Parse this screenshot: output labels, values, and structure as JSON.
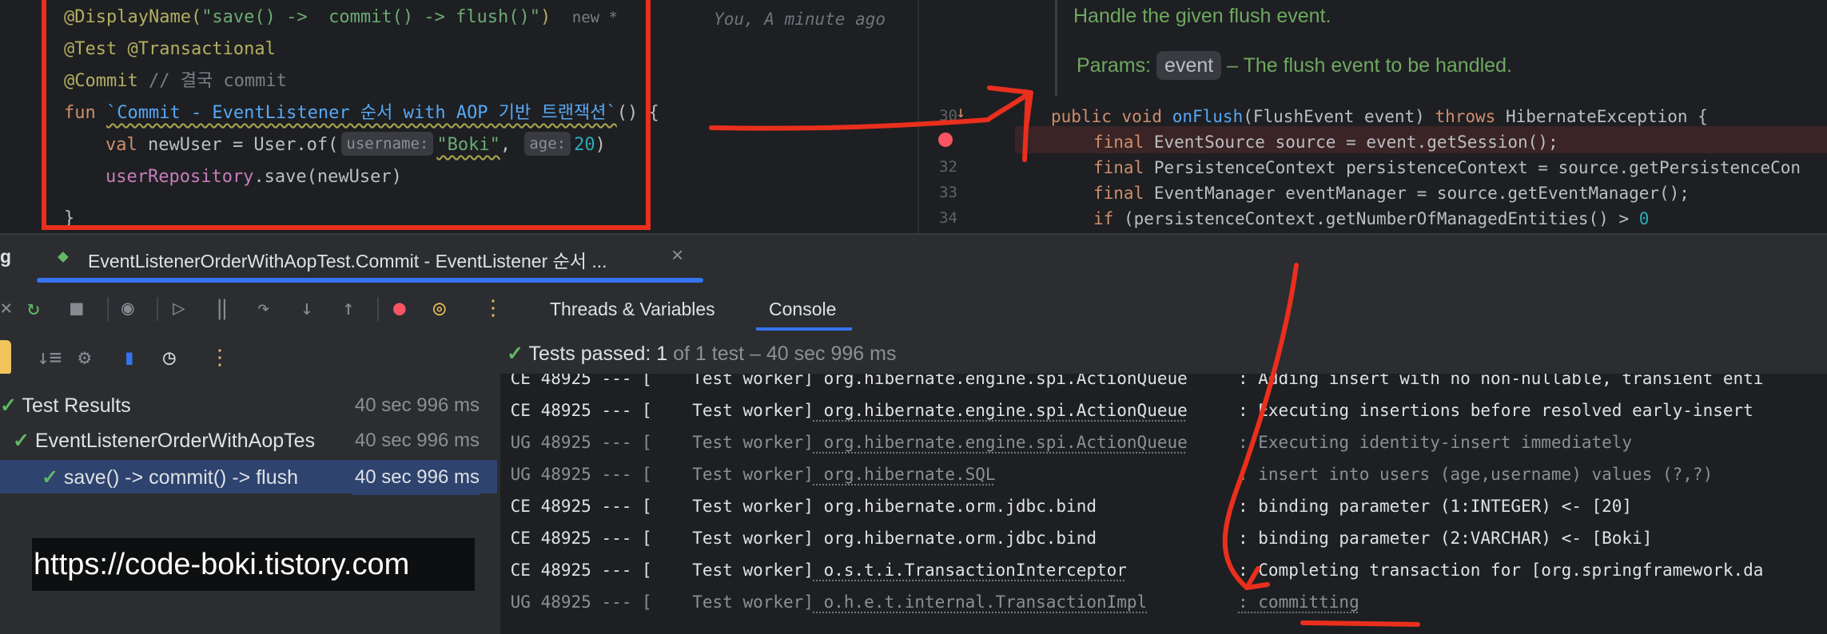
{
  "editor_left": {
    "line1_ann": "@DisplayName(",
    "line1_str": "\"save() ->  commit() -> flush()\"",
    "line1_close": ")",
    "line1_badge": "new *",
    "author": "You, A minute ago",
    "line2": "@Test @Transactional",
    "line3_ann": "@Commit",
    "line3_cmt": " // 결국 commit",
    "line4_kw": "fun ",
    "line4_name": "`Commit - EventListener 순서 with AOP 기반 트랜잭션`",
    "line4_tail": "() {",
    "line5_kw": "val ",
    "line5_a": "newUser = User.of(",
    "line5_hint1": "username:",
    "line5_str": "\"Boki\"",
    "line5_comma": ",",
    "line5_hint2": "age:",
    "line5_num": "20",
    "line5_close": ")",
    "line6_prop": "userRepository",
    "line6_rest": ".save(newUser)",
    "line7": "}"
  },
  "editor_right": {
    "doc_line1": "Handle the given flush event.",
    "doc_params": "Params:",
    "doc_chip": "event",
    "doc_desc": "– The flush event to be handled.",
    "gutter": [
      "30",
      "32",
      "33",
      "34"
    ],
    "code": {
      "l30_kw": "public void ",
      "l30_fn": "onFlush",
      "l30_a": "(FlushEvent event) ",
      "l30_kw2": "throws ",
      "l30_b": "HibernateException {",
      "l31_kw": "final ",
      "l31_a": "EventSource source = event.getSession();",
      "l32_kw": "final ",
      "l32_a": "PersistenceContext persistenceContext = source.getPersistenceCon",
      "l33_kw": "final ",
      "l33_a": "EventManager eventManager = source.getEventManager();",
      "l34_kw": "if ",
      "l34_a": "(persistenceContext.getNumberOfManagedEntities() > ",
      "l34_num": "0"
    }
  },
  "toolwindow": {
    "left_cut": "g",
    "tab_title": "EventListenerOrderWithAopTest.Commit - EventListener 순서 ...",
    "tab_close": "×",
    "tabs": [
      "Threads & Variables",
      "Console"
    ],
    "active_tab": "Console",
    "status": {
      "label": "Tests passed: ",
      "count": "1",
      "rest": " of 1 test – 40 sec 996 ms"
    }
  },
  "test_tree": [
    {
      "label": "Test Results",
      "time": "40 sec 996 ms"
    },
    {
      "label": "EventListenerOrderWithAopTes",
      "time": "40 sec 996 ms"
    },
    {
      "label": "save() -> commit() -> flush",
      "time": "40 sec 996 ms"
    }
  ],
  "console_lines": [
    {
      "lvl": "CE 48925 --- [",
      "thread": "    Test worker]",
      "logger": " org.hibernate.engine.spi.ActionQueue",
      "msg": ": Adding insert with no non-nullable, transient enti"
    },
    {
      "lvl": "CE 48925 --- [",
      "thread": "    Test worker]",
      "logger": " org.hibernate.engine.spi.ActionQueue",
      "msg": ": Executing insertions before resolved early-insert"
    },
    {
      "lvl": "UG 48925 --- [",
      "thread": "    Test worker]",
      "logger": " org.hibernate.engine.spi.ActionQueue",
      "msg": ": Executing identity-insert immediately"
    },
    {
      "lvl": "UG 48925 --- [",
      "thread": "    Test worker]",
      "logger": " org.hibernate.SQL",
      "msg": ": insert into users (age,username) values (?,?)"
    },
    {
      "lvl": "CE 48925 --- [",
      "thread": "    Test worker]",
      "logger": " org.hibernate.orm.jdbc.bind",
      "msg": ": binding parameter (1:INTEGER) <- [20]"
    },
    {
      "lvl": "CE 48925 --- [",
      "thread": "    Test worker]",
      "logger": " org.hibernate.orm.jdbc.bind",
      "msg": ": binding parameter (2:VARCHAR) <- [Boki]"
    },
    {
      "lvl": "CE 48925 --- [",
      "thread": "    Test worker]",
      "logger": " o.s.t.i.TransactionInterceptor",
      "msg": ": Completing transaction for [org.springframework.da"
    },
    {
      "lvl": "UG 48925 --- [",
      "thread": "    Test worker]",
      "logger": " o.h.e.t.internal.TransactionImpl",
      "msg": ": committing"
    }
  ],
  "watermark": "https://code-boki.tistory.com",
  "colors": {
    "annotation_red": "#ea2f1d",
    "accent_blue": "#3574f0",
    "pass_green": "#5fb865"
  }
}
